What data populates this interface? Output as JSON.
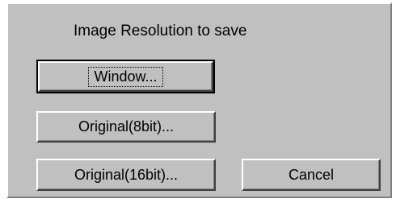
{
  "dialog": {
    "title": "Image Resolution to save",
    "buttons": {
      "window": "Window...",
      "original_8bit": "Original(8bit)...",
      "original_16bit": "Original(16bit)...",
      "cancel": "Cancel"
    }
  }
}
